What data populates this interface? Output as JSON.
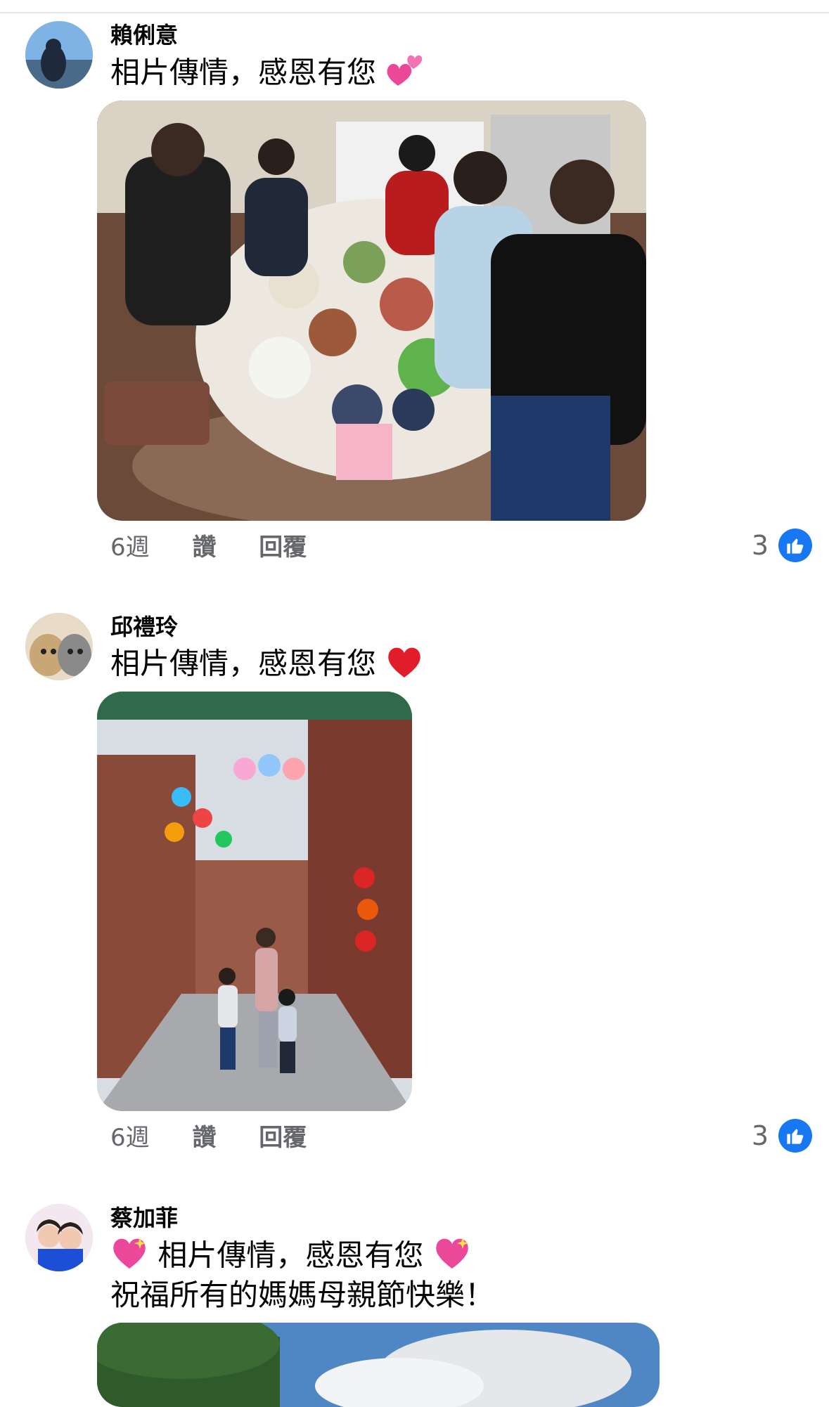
{
  "comments": [
    {
      "author": "賴俐意",
      "text": "相片傳情，感恩有您",
      "time": "6週",
      "like_label": "讚",
      "reply_label": "回覆",
      "reaction_count": "3"
    },
    {
      "author": "邱禮玲",
      "text": "相片傳情，感恩有您",
      "time": "6週",
      "like_label": "讚",
      "reply_label": "回覆",
      "reaction_count": "3"
    },
    {
      "author": "蔡加菲",
      "text": "相片傳情，感恩有您",
      "text_line2": "祝福所有的媽媽母親節快樂！"
    }
  ],
  "icons": {
    "reaction": "like-thumb-icon",
    "emoji1": "two-hearts-icon",
    "emoji2": "red-heart-icon",
    "emoji3": "sparkling-heart-icon"
  },
  "colors": {
    "like_blue": "#1877f2",
    "meta_gray": "#65676b",
    "heart_red": "#e11d2a",
    "heart_pink": "#ec4899"
  }
}
